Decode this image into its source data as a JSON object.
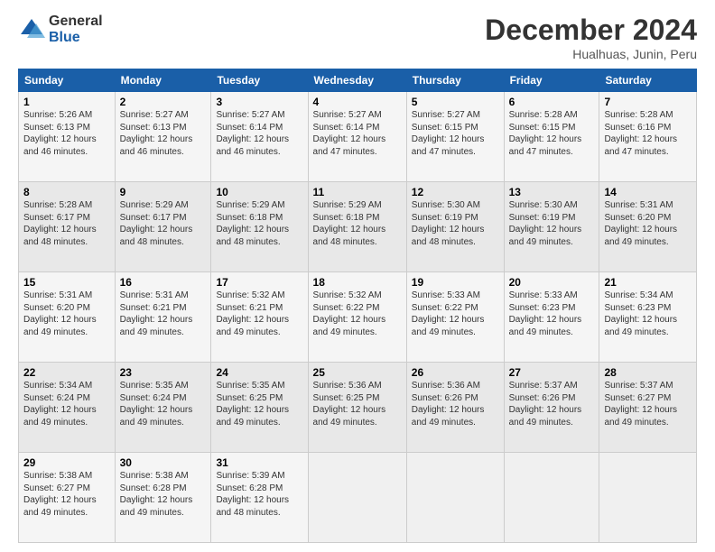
{
  "logo": {
    "general": "General",
    "blue": "Blue"
  },
  "header": {
    "title": "December 2024",
    "subtitle": "Hualhuas, Junin, Peru"
  },
  "days_of_week": [
    "Sunday",
    "Monday",
    "Tuesday",
    "Wednesday",
    "Thursday",
    "Friday",
    "Saturday"
  ],
  "weeks": [
    [
      {
        "day": "1",
        "sunrise": "Sunrise: 5:26 AM",
        "sunset": "Sunset: 6:13 PM",
        "daylight": "Daylight: 12 hours and 46 minutes."
      },
      {
        "day": "2",
        "sunrise": "Sunrise: 5:27 AM",
        "sunset": "Sunset: 6:13 PM",
        "daylight": "Daylight: 12 hours and 46 minutes."
      },
      {
        "day": "3",
        "sunrise": "Sunrise: 5:27 AM",
        "sunset": "Sunset: 6:14 PM",
        "daylight": "Daylight: 12 hours and 46 minutes."
      },
      {
        "day": "4",
        "sunrise": "Sunrise: 5:27 AM",
        "sunset": "Sunset: 6:14 PM",
        "daylight": "Daylight: 12 hours and 47 minutes."
      },
      {
        "day": "5",
        "sunrise": "Sunrise: 5:27 AM",
        "sunset": "Sunset: 6:15 PM",
        "daylight": "Daylight: 12 hours and 47 minutes."
      },
      {
        "day": "6",
        "sunrise": "Sunrise: 5:28 AM",
        "sunset": "Sunset: 6:15 PM",
        "daylight": "Daylight: 12 hours and 47 minutes."
      },
      {
        "day": "7",
        "sunrise": "Sunrise: 5:28 AM",
        "sunset": "Sunset: 6:16 PM",
        "daylight": "Daylight: 12 hours and 47 minutes."
      }
    ],
    [
      {
        "day": "8",
        "sunrise": "Sunrise: 5:28 AM",
        "sunset": "Sunset: 6:17 PM",
        "daylight": "Daylight: 12 hours and 48 minutes."
      },
      {
        "day": "9",
        "sunrise": "Sunrise: 5:29 AM",
        "sunset": "Sunset: 6:17 PM",
        "daylight": "Daylight: 12 hours and 48 minutes."
      },
      {
        "day": "10",
        "sunrise": "Sunrise: 5:29 AM",
        "sunset": "Sunset: 6:18 PM",
        "daylight": "Daylight: 12 hours and 48 minutes."
      },
      {
        "day": "11",
        "sunrise": "Sunrise: 5:29 AM",
        "sunset": "Sunset: 6:18 PM",
        "daylight": "Daylight: 12 hours and 48 minutes."
      },
      {
        "day": "12",
        "sunrise": "Sunrise: 5:30 AM",
        "sunset": "Sunset: 6:19 PM",
        "daylight": "Daylight: 12 hours and 48 minutes."
      },
      {
        "day": "13",
        "sunrise": "Sunrise: 5:30 AM",
        "sunset": "Sunset: 6:19 PM",
        "daylight": "Daylight: 12 hours and 49 minutes."
      },
      {
        "day": "14",
        "sunrise": "Sunrise: 5:31 AM",
        "sunset": "Sunset: 6:20 PM",
        "daylight": "Daylight: 12 hours and 49 minutes."
      }
    ],
    [
      {
        "day": "15",
        "sunrise": "Sunrise: 5:31 AM",
        "sunset": "Sunset: 6:20 PM",
        "daylight": "Daylight: 12 hours and 49 minutes."
      },
      {
        "day": "16",
        "sunrise": "Sunrise: 5:31 AM",
        "sunset": "Sunset: 6:21 PM",
        "daylight": "Daylight: 12 hours and 49 minutes."
      },
      {
        "day": "17",
        "sunrise": "Sunrise: 5:32 AM",
        "sunset": "Sunset: 6:21 PM",
        "daylight": "Daylight: 12 hours and 49 minutes."
      },
      {
        "day": "18",
        "sunrise": "Sunrise: 5:32 AM",
        "sunset": "Sunset: 6:22 PM",
        "daylight": "Daylight: 12 hours and 49 minutes."
      },
      {
        "day": "19",
        "sunrise": "Sunrise: 5:33 AM",
        "sunset": "Sunset: 6:22 PM",
        "daylight": "Daylight: 12 hours and 49 minutes."
      },
      {
        "day": "20",
        "sunrise": "Sunrise: 5:33 AM",
        "sunset": "Sunset: 6:23 PM",
        "daylight": "Daylight: 12 hours and 49 minutes."
      },
      {
        "day": "21",
        "sunrise": "Sunrise: 5:34 AM",
        "sunset": "Sunset: 6:23 PM",
        "daylight": "Daylight: 12 hours and 49 minutes."
      }
    ],
    [
      {
        "day": "22",
        "sunrise": "Sunrise: 5:34 AM",
        "sunset": "Sunset: 6:24 PM",
        "daylight": "Daylight: 12 hours and 49 minutes."
      },
      {
        "day": "23",
        "sunrise": "Sunrise: 5:35 AM",
        "sunset": "Sunset: 6:24 PM",
        "daylight": "Daylight: 12 hours and 49 minutes."
      },
      {
        "day": "24",
        "sunrise": "Sunrise: 5:35 AM",
        "sunset": "Sunset: 6:25 PM",
        "daylight": "Daylight: 12 hours and 49 minutes."
      },
      {
        "day": "25",
        "sunrise": "Sunrise: 5:36 AM",
        "sunset": "Sunset: 6:25 PM",
        "daylight": "Daylight: 12 hours and 49 minutes."
      },
      {
        "day": "26",
        "sunrise": "Sunrise: 5:36 AM",
        "sunset": "Sunset: 6:26 PM",
        "daylight": "Daylight: 12 hours and 49 minutes."
      },
      {
        "day": "27",
        "sunrise": "Sunrise: 5:37 AM",
        "sunset": "Sunset: 6:26 PM",
        "daylight": "Daylight: 12 hours and 49 minutes."
      },
      {
        "day": "28",
        "sunrise": "Sunrise: 5:37 AM",
        "sunset": "Sunset: 6:27 PM",
        "daylight": "Daylight: 12 hours and 49 minutes."
      }
    ],
    [
      {
        "day": "29",
        "sunrise": "Sunrise: 5:38 AM",
        "sunset": "Sunset: 6:27 PM",
        "daylight": "Daylight: 12 hours and 49 minutes."
      },
      {
        "day": "30",
        "sunrise": "Sunrise: 5:38 AM",
        "sunset": "Sunset: 6:28 PM",
        "daylight": "Daylight: 12 hours and 49 minutes."
      },
      {
        "day": "31",
        "sunrise": "Sunrise: 5:39 AM",
        "sunset": "Sunset: 6:28 PM",
        "daylight": "Daylight: 12 hours and 48 minutes."
      },
      null,
      null,
      null,
      null
    ]
  ]
}
